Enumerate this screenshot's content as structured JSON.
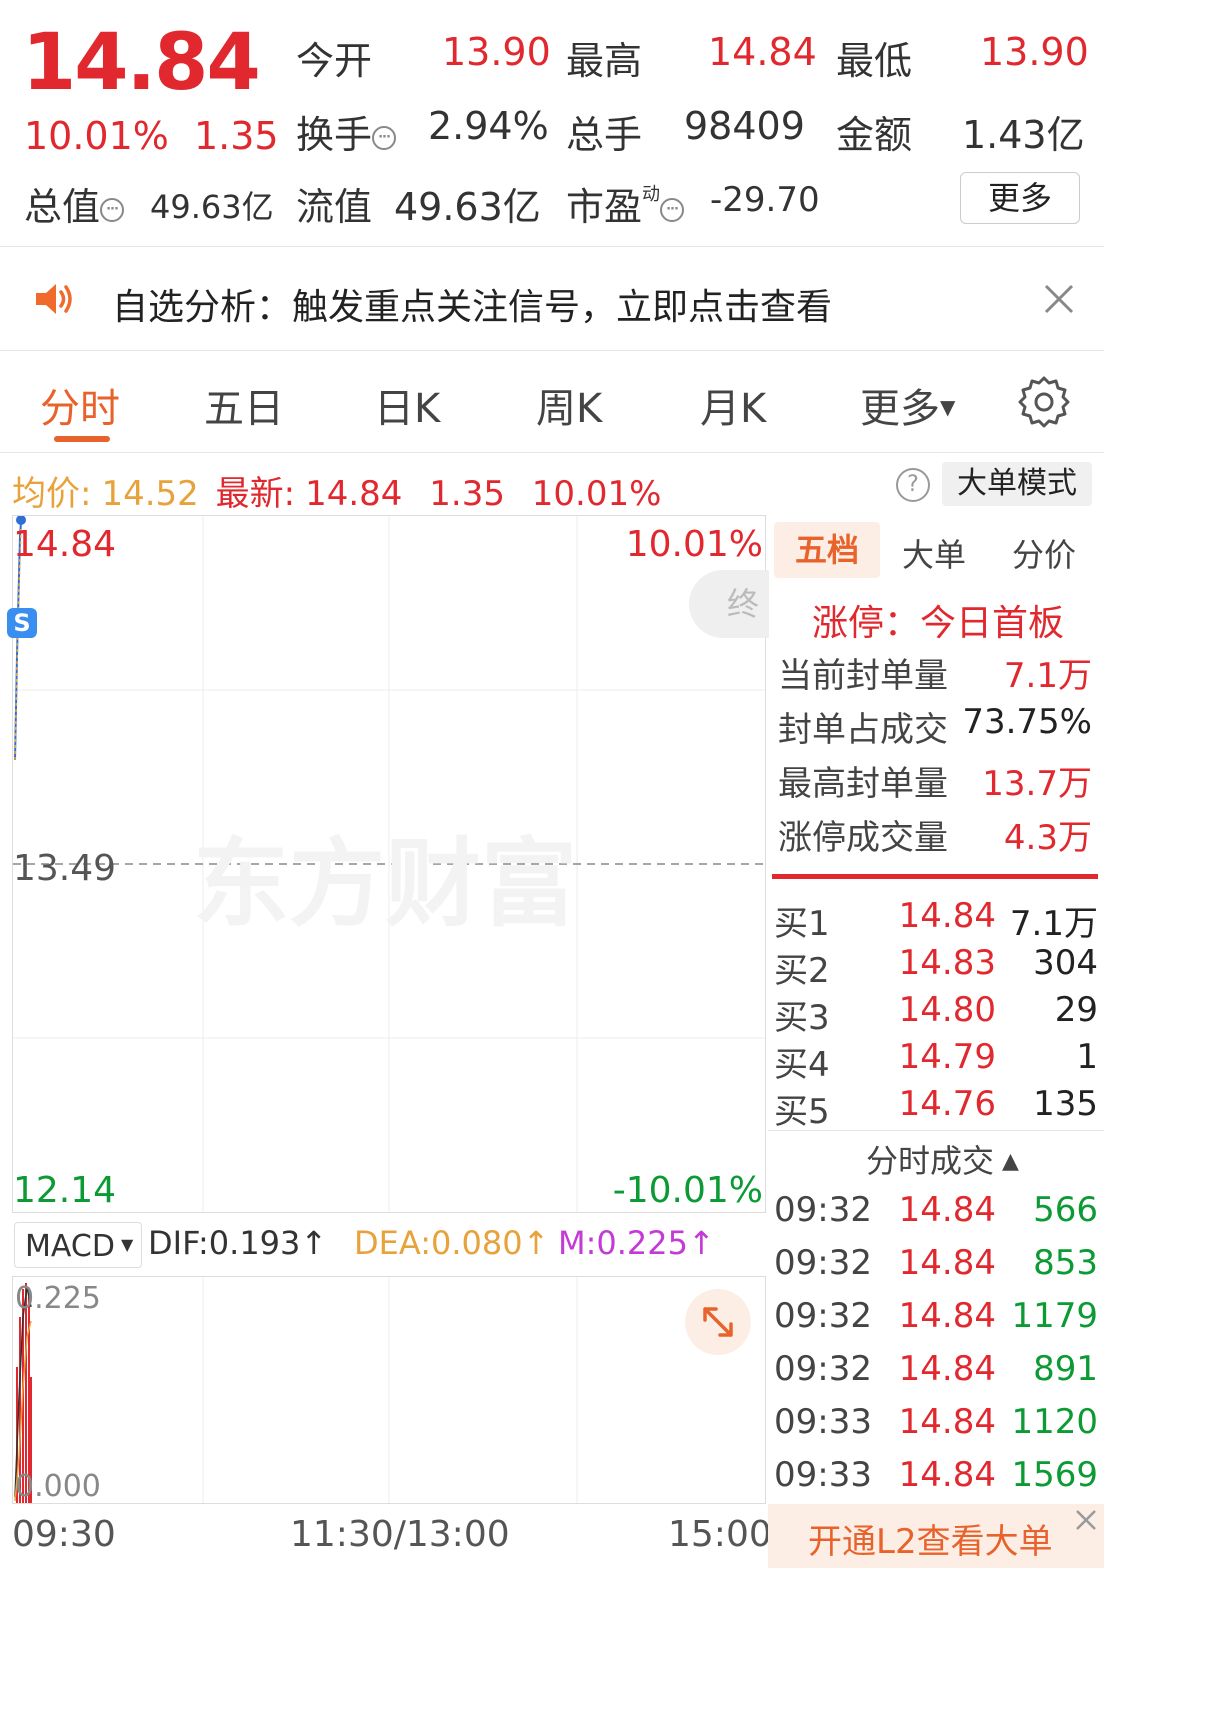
{
  "quote": {
    "price": "14.84",
    "change_pct": "10.01%",
    "change": "1.35",
    "open_label": "今开",
    "open": "13.90",
    "high_label": "最高",
    "high": "14.84",
    "low_label": "最低",
    "low": "13.90",
    "turnover_label": "换手",
    "turnover": "2.94%",
    "volume_label": "总手",
    "volume": "98409",
    "amount_label": "金额",
    "amount": "1.43亿",
    "mktcap_label": "总值",
    "mktcap": "49.63亿",
    "float_label": "流值",
    "float_cap": "49.63亿",
    "pe_label": "市盈",
    "pe_sup": "动",
    "pe": "-29.70",
    "more_button": "更多"
  },
  "banner": {
    "text": "自选分析：触发重点关注信号，立即点击查看"
  },
  "tabs": {
    "items": [
      "分时",
      "五日",
      "日K",
      "周K",
      "月K",
      "更多"
    ],
    "active": "分时"
  },
  "summary": {
    "avg_label": "均价:",
    "avg": "14.52",
    "last_label": "最新:",
    "last": "14.84",
    "change": "1.35",
    "change_pct": "10.01%",
    "mode_button": "大单模式"
  },
  "chart": {
    "top_price": "14.84",
    "top_pct": "10.01%",
    "mid_price": "13.49",
    "bottom_price": "12.14",
    "bottom_pct": "-10.01%",
    "watermark": "东方财富",
    "badge": "S",
    "end_chip": "终"
  },
  "macd": {
    "name": "MACD",
    "dif": "DIF:0.193↑",
    "dea": "DEA:0.080↑",
    "m": "M:0.225↑",
    "top_value": "0.225",
    "bottom_value": "0.000"
  },
  "time_axis": {
    "start": "09:30",
    "mid": "11:30/13:00",
    "end": "15:00"
  },
  "orderbook": {
    "tabs": [
      "五档",
      "大单",
      "分价"
    ],
    "limit_status": "涨停：今日首板",
    "stats": [
      {
        "label": "当前封单量",
        "value": "7.1万"
      },
      {
        "label": "封单占成交",
        "value": "73.75%"
      },
      {
        "label": "最高封单量",
        "value": "13.7万"
      },
      {
        "label": "涨停成交量",
        "value": "4.3万"
      }
    ],
    "bids": [
      {
        "label": "买1",
        "price": "14.84",
        "qty": "7.1万"
      },
      {
        "label": "买2",
        "price": "14.83",
        "qty": "304"
      },
      {
        "label": "买3",
        "price": "14.80",
        "qty": "29"
      },
      {
        "label": "买4",
        "price": "14.79",
        "qty": "1"
      },
      {
        "label": "买5",
        "price": "14.76",
        "qty": "135"
      }
    ],
    "trades_header": "分时成交",
    "trades": [
      {
        "time": "09:32",
        "price": "14.84",
        "vol": "566"
      },
      {
        "time": "09:32",
        "price": "14.84",
        "vol": "853"
      },
      {
        "time": "09:32",
        "price": "14.84",
        "vol": "1179"
      },
      {
        "time": "09:32",
        "price": "14.84",
        "vol": "891"
      },
      {
        "time": "09:33",
        "price": "14.84",
        "vol": "1120"
      },
      {
        "time": "09:33",
        "price": "14.84",
        "vol": "1569"
      }
    ],
    "l2_promo": "开通L2查看大单"
  },
  "colors": {
    "up": "#e0282e",
    "down": "#0c9a35",
    "accent": "#e8632b",
    "avg": "#e8a23b",
    "magenta": "#c43ad6"
  }
}
